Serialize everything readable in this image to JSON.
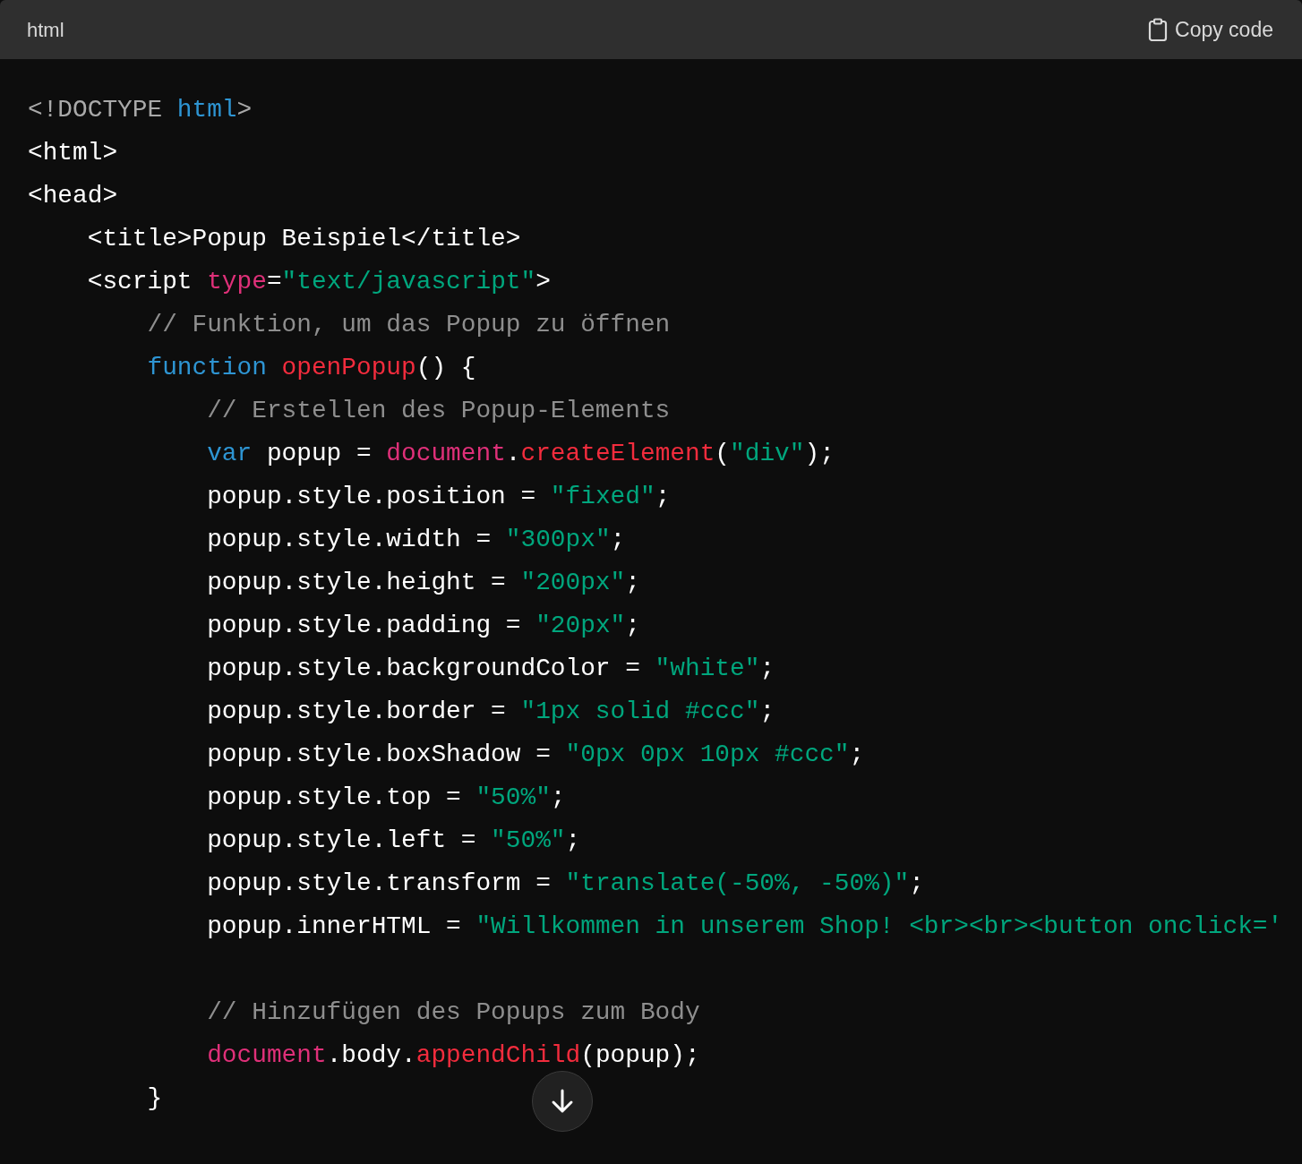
{
  "header": {
    "language": "html",
    "copy_button": "Copy code"
  },
  "code_lines": [
    {
      "tokens": [
        {
          "kind": "doctype",
          "text": "<!DOCTYPE "
        },
        {
          "kind": "keyword",
          "text": "html"
        },
        {
          "kind": "doctype",
          "text": ">"
        }
      ]
    },
    {
      "tokens": [
        {
          "kind": "plain",
          "text": "<html>"
        }
      ]
    },
    {
      "tokens": [
        {
          "kind": "plain",
          "text": "<head>"
        }
      ]
    },
    {
      "tokens": [
        {
          "kind": "plain",
          "text": "    <title>Popup Beispiel</title>"
        }
      ]
    },
    {
      "tokens": [
        {
          "kind": "plain",
          "text": "    <script "
        },
        {
          "kind": "attr",
          "text": "type"
        },
        {
          "kind": "plain",
          "text": "="
        },
        {
          "kind": "string",
          "text": "\"text/javascript\""
        },
        {
          "kind": "plain",
          "text": ">"
        }
      ]
    },
    {
      "tokens": [
        {
          "kind": "comment",
          "text": "        // Funktion, um das Popup zu öffnen"
        }
      ]
    },
    {
      "tokens": [
        {
          "kind": "keyword",
          "text": "        function "
        },
        {
          "kind": "func",
          "text": "openPopup"
        },
        {
          "kind": "plain",
          "text": "() {"
        }
      ]
    },
    {
      "tokens": [
        {
          "kind": "comment",
          "text": "            // Erstellen des Popup-Elements"
        }
      ]
    },
    {
      "tokens": [
        {
          "kind": "keyword",
          "text": "            var"
        },
        {
          "kind": "plain",
          "text": " popup = "
        },
        {
          "kind": "object",
          "text": "document"
        },
        {
          "kind": "plain",
          "text": "."
        },
        {
          "kind": "func",
          "text": "createElement"
        },
        {
          "kind": "plain",
          "text": "("
        },
        {
          "kind": "string",
          "text": "\"div\""
        },
        {
          "kind": "plain",
          "text": ");"
        }
      ]
    },
    {
      "tokens": [
        {
          "kind": "plain",
          "text": "            popup.style.position = "
        },
        {
          "kind": "string",
          "text": "\"fixed\""
        },
        {
          "kind": "plain",
          "text": ";"
        }
      ]
    },
    {
      "tokens": [
        {
          "kind": "plain",
          "text": "            popup.style.width = "
        },
        {
          "kind": "string",
          "text": "\"300px\""
        },
        {
          "kind": "plain",
          "text": ";"
        }
      ]
    },
    {
      "tokens": [
        {
          "kind": "plain",
          "text": "            popup.style.height = "
        },
        {
          "kind": "string",
          "text": "\"200px\""
        },
        {
          "kind": "plain",
          "text": ";"
        }
      ]
    },
    {
      "tokens": [
        {
          "kind": "plain",
          "text": "            popup.style.padding = "
        },
        {
          "kind": "string",
          "text": "\"20px\""
        },
        {
          "kind": "plain",
          "text": ";"
        }
      ]
    },
    {
      "tokens": [
        {
          "kind": "plain",
          "text": "            popup.style.backgroundColor = "
        },
        {
          "kind": "string",
          "text": "\"white\""
        },
        {
          "kind": "plain",
          "text": ";"
        }
      ]
    },
    {
      "tokens": [
        {
          "kind": "plain",
          "text": "            popup.style.border = "
        },
        {
          "kind": "string",
          "text": "\"1px solid #ccc\""
        },
        {
          "kind": "plain",
          "text": ";"
        }
      ]
    },
    {
      "tokens": [
        {
          "kind": "plain",
          "text": "            popup.style.boxShadow = "
        },
        {
          "kind": "string",
          "text": "\"0px 0px 10px #ccc\""
        },
        {
          "kind": "plain",
          "text": ";"
        }
      ]
    },
    {
      "tokens": [
        {
          "kind": "plain",
          "text": "            popup.style.top = "
        },
        {
          "kind": "string",
          "text": "\"50%\""
        },
        {
          "kind": "plain",
          "text": ";"
        }
      ]
    },
    {
      "tokens": [
        {
          "kind": "plain",
          "text": "            popup.style.left = "
        },
        {
          "kind": "string",
          "text": "\"50%\""
        },
        {
          "kind": "plain",
          "text": ";"
        }
      ]
    },
    {
      "tokens": [
        {
          "kind": "plain",
          "text": "            popup.style.transform = "
        },
        {
          "kind": "string",
          "text": "\"translate(-50%, -50%)\""
        },
        {
          "kind": "plain",
          "text": ";"
        }
      ]
    },
    {
      "tokens": [
        {
          "kind": "plain",
          "text": "            popup.innerHTML = "
        },
        {
          "kind": "string",
          "text": "\"Willkommen in unserem Shop! <br><br><button onclick='"
        }
      ]
    },
    {
      "kind": "blank"
    },
    {
      "tokens": [
        {
          "kind": "comment",
          "text": "            // Hinzufügen des Popups zum Body"
        }
      ]
    },
    {
      "tokens": [
        {
          "kind": "object",
          "text": "            document"
        },
        {
          "kind": "plain",
          "text": ".body."
        },
        {
          "kind": "func",
          "text": "appendChild"
        },
        {
          "kind": "plain",
          "text": "(popup);"
        }
      ]
    },
    {
      "tokens": [
        {
          "kind": "plain",
          "text": "        }"
        }
      ]
    }
  ]
}
